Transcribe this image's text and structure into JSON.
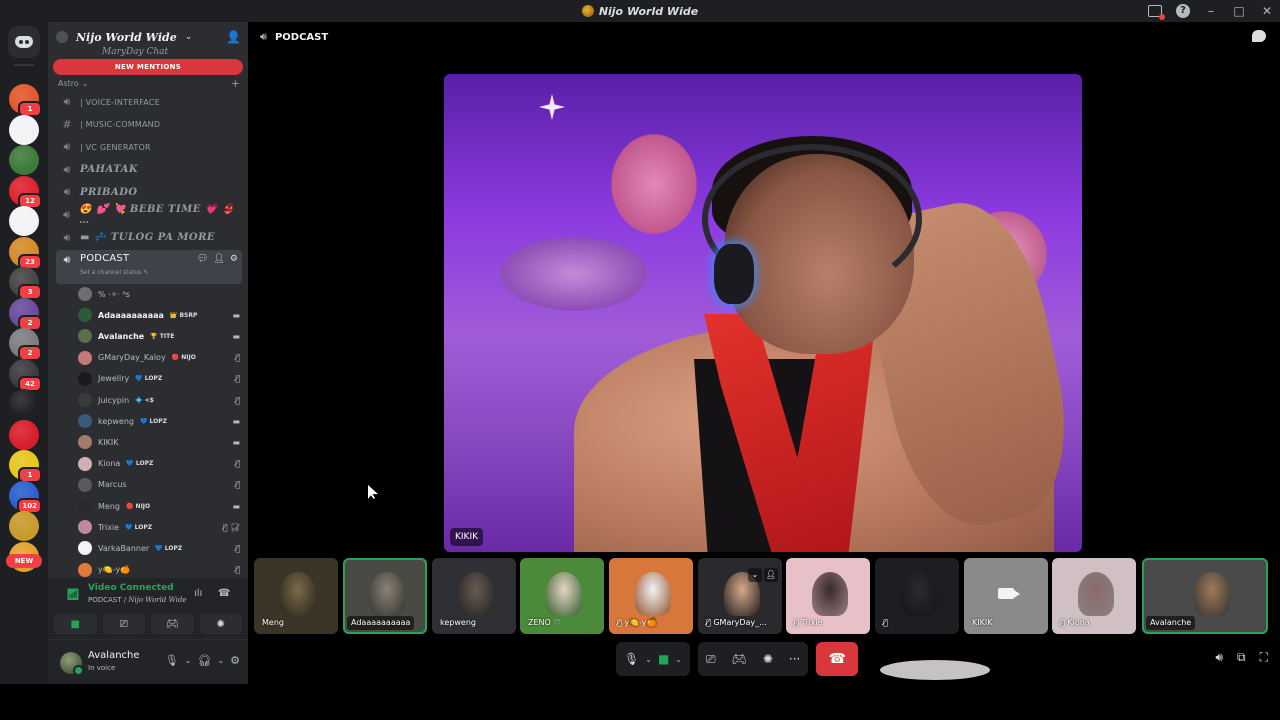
{
  "window": {
    "title": "Nijo World Wide"
  },
  "rail": {
    "servers": [
      {
        "badge": "1",
        "color": "#e3572a"
      },
      {
        "badge": "",
        "color": "#f2f3f5"
      },
      {
        "badge": "",
        "color": "#3e7a3a"
      },
      {
        "badge": "12",
        "color": "#e02030"
      },
      {
        "badge": "",
        "color": "#f2f3f5"
      },
      {
        "badge": "23",
        "color": "#d48a2a"
      },
      {
        "badge": "3",
        "color": "#444444"
      },
      {
        "badge": "2",
        "color": "#6a4a9a"
      },
      {
        "badge": "2",
        "color": "#7d7d80"
      },
      {
        "badge": "42",
        "color": "#3a3a3f"
      },
      {
        "badge": "",
        "color": "#202024"
      },
      {
        "badge": "",
        "color": "#d81e2a"
      },
      {
        "badge": "1",
        "color": "#e7c61c"
      },
      {
        "badge": "102",
        "color": "#2a5fd0"
      },
      {
        "badge": "",
        "color": "#c79a2a"
      },
      {
        "badge": "",
        "color": "#e3a12a"
      }
    ],
    "new_label": "NEW"
  },
  "sidebar": {
    "server_name": "Nijo World Wide",
    "cut_channel": "MaryDay Chat",
    "new_mentions": "NEW MENTIONS",
    "category": "Astro",
    "channels": [
      {
        "icon": "speaker-icon",
        "label": "| VOICE-INTERFACE",
        "style": "small"
      },
      {
        "icon": "hash-icon",
        "label": "| MUSIC-COMMAND",
        "style": "small"
      },
      {
        "icon": "speaker-icon",
        "label": "| VC GENERATOR",
        "style": "small"
      },
      {
        "icon": "speaker-icon",
        "label": "PAHATAK",
        "style": "big"
      },
      {
        "icon": "speaker-icon",
        "label": "PRIBADO",
        "style": "big"
      },
      {
        "icon": "speaker-icon",
        "label": "😍 💕 💘  BEBE TIME  💗 👙 …",
        "style": "big"
      },
      {
        "icon": "speaker-icon",
        "label": "▬ 💤  TULOG PA MORE",
        "style": "big"
      }
    ],
    "active_channel": {
      "label": "PODCAST",
      "status": "Set a channel status ✎"
    },
    "members": [
      {
        "name": "% ·✧· ⁶s",
        "tag": "",
        "status": "",
        "bright": false,
        "color": "#6e6e6e"
      },
      {
        "name": "Adaaaaaaaaaa",
        "tag": "👑 BSRP",
        "status": "▬",
        "bright": true,
        "color": "#2f5a3a"
      },
      {
        "name": "Avalanche",
        "tag": "🏆 TITE",
        "status": "▬",
        "bright": true,
        "color": "#5a6e4a"
      },
      {
        "name": "GMaryDay_Kaloy",
        "tag": "🔴 NIJO",
        "status": "🎙̸",
        "bright": false,
        "color": "#c47a7a"
      },
      {
        "name": "Jewellry",
        "tag": "💙 LOPZ",
        "status": "🎙̸",
        "bright": false,
        "color": "#1a1a1a"
      },
      {
        "name": "Juicypin",
        "tag": "💠 <$",
        "status": "🎙̸",
        "bright": false,
        "color": "#3a3a3a"
      },
      {
        "name": "kepweng",
        "tag": "💙 LOPZ",
        "status": "▬",
        "bright": false,
        "color": "#3a5a7a"
      },
      {
        "name": "KIKIK",
        "tag": "",
        "status": "▬",
        "bright": false,
        "color": "#a47a6a"
      },
      {
        "name": "Kiona",
        "tag": "💙 LOPZ",
        "status": "🎙̸",
        "bright": false,
        "color": "#d0b0b8"
      },
      {
        "name": "Marcus",
        "tag": "",
        "status": "🎙̸",
        "bright": false,
        "color": "#5a5a5a"
      },
      {
        "name": "Meng",
        "tag": "🔴 NIJO",
        "status": "▬",
        "bright": false,
        "color": "#2a2a2a"
      },
      {
        "name": "Trixie",
        "tag": "💙 LOPZ",
        "status": "🎙̸ 🎧̸",
        "bright": false,
        "color": "#c08a9a"
      },
      {
        "name": "VarkaBanner",
        "tag": "💙 LOPZ",
        "status": "🎙̸",
        "bright": false,
        "color": "#f2f3f5"
      },
      {
        "name": "y🍋-y🍊",
        "tag": "",
        "status": "🎙̸",
        "bright": false,
        "color": "#e07a3a"
      }
    ]
  },
  "voice": {
    "connected_label": "Video Connected",
    "channel_path": "PODCAST / ",
    "server": "Nijo World Wide"
  },
  "user": {
    "name": "Avalanche",
    "status": "In voice"
  },
  "stage": {
    "channel_title": "PODCAST",
    "main_video_name": "KIKIK",
    "tiles": [
      {
        "name": "Meng",
        "bg": "#3a3526",
        "fig": "#7a6a4a",
        "speaking": false,
        "cam_off": false,
        "muted": false
      },
      {
        "name": "Adaaaaaaaaaa",
        "bg": "#4a4a44",
        "fig": "#8a8376",
        "speaking": true,
        "cam_off": false,
        "muted": false
      },
      {
        "name": "kepweng",
        "bg": "#2f3034",
        "fig": "#6a5a50",
        "speaking": false,
        "cam_off": false,
        "muted": false
      },
      {
        "name": "ZENO ♡",
        "bg": "#4a8a3a",
        "fig": "#e6d4c8",
        "speaking": false,
        "cam_off": false,
        "muted": false
      },
      {
        "name": "y🍋-y🍊",
        "bg": "#d8773c",
        "fig": "#f2f3f5",
        "speaking": false,
        "cam_off": false,
        "muted": true
      },
      {
        "name": "GMaryDay_...",
        "bg": "#2a2a2e",
        "fig": "#d9a98a",
        "speaking": false,
        "cam_off": false,
        "muted": true
      },
      {
        "name": "Trixie",
        "bg": "#e8c0c8",
        "fig": "#3a2a2a",
        "speaking": false,
        "cam_off": false,
        "muted": true
      },
      {
        "name": "",
        "bg": "#1e1e22",
        "fig": "#2a2a30",
        "speaking": false,
        "cam_off": false,
        "muted": true
      },
      {
        "name": "KIKIK",
        "bg": "#8a8a8c",
        "fig": "#8a8a8c",
        "speaking": false,
        "cam_off": true,
        "muted": false
      },
      {
        "name": "Kiona",
        "bg": "#d0c0c4",
        "fig": "#8a6a6a",
        "speaking": false,
        "cam_off": false,
        "muted": true
      },
      {
        "name": "Avalanche",
        "bg": "#4a4a4a",
        "fig": "#a07a5a",
        "speaking": true,
        "cam_off": false,
        "muted": false
      }
    ]
  },
  "colors": {
    "accent_green": "#23a559",
    "danger_red": "#da373c",
    "sidebar_bg": "#2b2d31",
    "rail_bg": "#1e1f22"
  }
}
